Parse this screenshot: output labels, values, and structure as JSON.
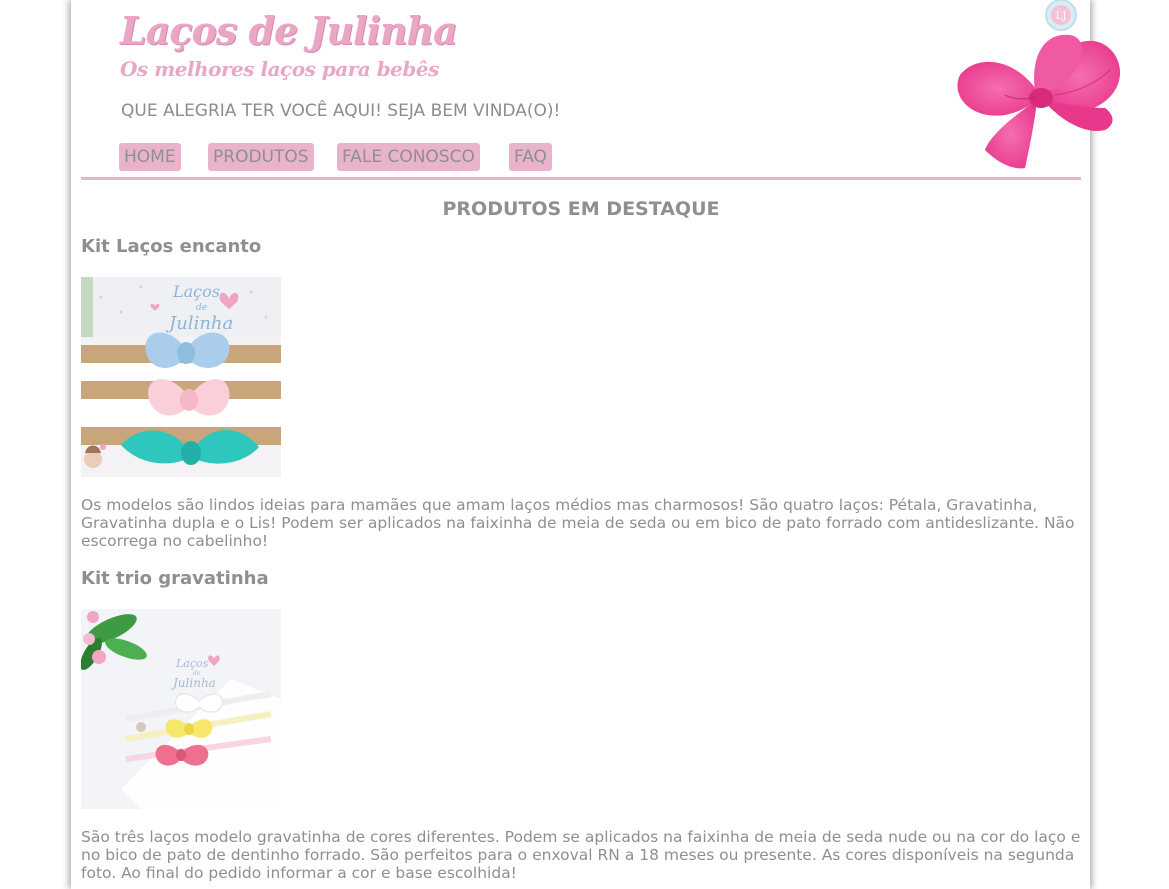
{
  "header": {
    "brand_title": "Laços de Julinha",
    "brand_subtitle": "Os melhores laços para bebês",
    "welcome": "QUE ALEGRIA TER VOCÊ AQUI! SEJA BEM VINDA(O)!",
    "logo_badge": "LJ"
  },
  "nav": {
    "items": [
      {
        "label": "HOME"
      },
      {
        "label": "PRODUTOS"
      },
      {
        "label": "FALE CONOSCO"
      },
      {
        "label": "FAQ"
      }
    ]
  },
  "colors": {
    "accent_pink": "#eab3cc",
    "text_gray": "#8f8f8f",
    "bow_pink": "#f2479a"
  },
  "main": {
    "section_title": "PRODUTOS EM DESTAQUE",
    "products": [
      {
        "title": "Kit Laços encanto",
        "image_logo_line1": "Laços",
        "image_logo_line2": "de",
        "image_logo_line3": "Julinha",
        "description": "Os modelos são lindos ideias para mamães que amam laços médios mas charmosos! São quatro laços: Pétala, Gravatinha, Gravatinha dupla e o Lis! Podem ser aplicados na faixinha de meia de seda ou em bico de pato forrado com antideslizante. Não escorrega no cabelinho!"
      },
      {
        "title": "Kit trio gravatinha",
        "image_logo_line1": "Laços",
        "image_logo_line2": "de",
        "image_logo_line3": "Julinha",
        "description": "São três laços modelo gravatinha de cores diferentes. Podem se aplicados na faixinha de meia de seda nude ou na cor do laço e no bico de pato de dentinho forrado. São perfeitos para o enxoval RN a 18 meses ou presente. As cores disponíveis na segunda foto. Ao final do pedido informar a cor e base escolhida!"
      }
    ]
  }
}
